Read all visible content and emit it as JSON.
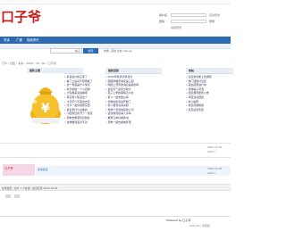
{
  "header": {
    "logo_text": "口子爷",
    "user_label": "用户名",
    "pass_label": "密码",
    "remember": "自动登录",
    "find_pass": "找回密码",
    "login_btn": "登录",
    "register": "立即注册",
    "quick_login": "快捷登录"
  },
  "nav": {
    "items": [
      "导读",
      "广播",
      "指南资讯"
    ]
  },
  "search": {
    "select_label": "帖子",
    "button": "搜索",
    "hot_words": "热搜: 活动 交友 discuz"
  },
  "breadcrumb": "门户 › 社区 › 头条 › 2020 › 12 › 01 › 口子爷",
  "columns": {
    "col1_title": "最新主题",
    "col2_title": "最新回复",
    "col3_title": "热帖"
  },
  "col1_items": [
    "补货后价格又涨了",
    "看了之后就不想再看了",
    "这个到底是什么情况",
    "新手求助一个小问题",
    "大家都来说说看吧",
    "有没有人知道这个",
    "今天天气不错出去玩",
    "分享一些好用的东西",
    "最近有什么好看的",
    "小区附近新开了一家店",
    "周末去哪里玩比较好",
    "这样做到底对不对"
  ],
  "col2_items": [
    "2020年新款手机对比",
    "跟我学做家常菜第三期",
    "网络上流传的消息是真的吗",
    "最近天气变化比较大",
    "孩子上学的事情怎么办",
    "有人一起去爬山吗",
    "旧物交换活动开始了",
    "新人报到请多关照",
    "想找个靠谱的装修公司",
    "这款游戏值得入手吗",
    "推荐几本好看的书",
    "周末一起去看电影吧"
  ],
  "col3_items": [
    "论坛新功能上线通知",
    "热门话题讨论区",
    "版主招募进行中",
    "优秀帖子评选",
    "社区规则更新公告",
    "年度活动回顾",
    "新人指南",
    "常见问题解答",
    "意见反馈专区"
  ],
  "middle_rows": [
    {
      "date": "2020-12-01",
      "author": "admin"
    },
    {
      "date": "2020-12-01",
      "author": "admin"
    }
  ],
  "friend_link_title": "友情链接",
  "banner_text": "口子爷",
  "footer": {
    "online": "在线会员 - 总计 1 人在线 - 最高纪录 2020-12-01",
    "copyright": "Powered by 口子爷",
    "archiver": "Archiver | 手机版",
    "stats": "GMT+8, 2020-12-01"
  },
  "colors": {
    "brand": "#c81d1d",
    "nav": "#2b6ab3",
    "pink_banner": "#f4d6e6"
  }
}
